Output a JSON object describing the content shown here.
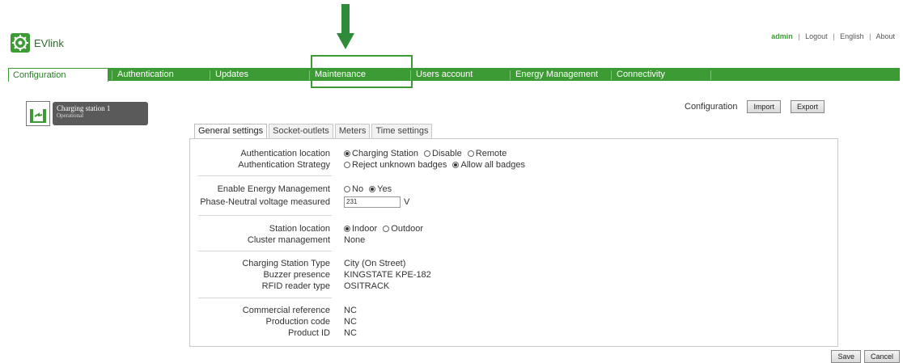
{
  "header": {
    "app_name": "EVlink",
    "user": "admin",
    "links": [
      "Logout",
      "English",
      "About"
    ],
    "separator": "|"
  },
  "nav": {
    "tabs": [
      {
        "label": "Configuration",
        "active": true
      },
      {
        "label": "Authentication",
        "active": false
      },
      {
        "label": "Updates",
        "active": false
      },
      {
        "label": "Maintenance",
        "active": false
      },
      {
        "label": "Users account",
        "active": false
      },
      {
        "label": "Energy Management",
        "active": false
      },
      {
        "label": "Connectivity",
        "active": false
      }
    ],
    "highlighted_tab": "Maintenance"
  },
  "station": {
    "name": "Charging station 1",
    "status": "Operational"
  },
  "config_bar": {
    "label": "Configuration",
    "import_label": "Import",
    "export_label": "Export"
  },
  "subtabs": [
    {
      "label": "General settings",
      "active": true
    },
    {
      "label": "Socket-outlets",
      "active": false
    },
    {
      "label": "Meters",
      "active": false
    },
    {
      "label": "Time settings",
      "active": false
    }
  ],
  "form": {
    "auth_location": {
      "label": "Authentication location",
      "options": [
        "Charging Station",
        "Disable",
        "Remote"
      ],
      "selected": "Charging Station"
    },
    "auth_strategy": {
      "label": "Authentication Strategy",
      "options": [
        "Reject unknown badges",
        "Allow all badges"
      ],
      "selected": "Allow all badges"
    },
    "energy_mgmt": {
      "label": "Enable Energy Management",
      "options": [
        "No",
        "Yes"
      ],
      "selected": "Yes"
    },
    "voltage": {
      "label": "Phase-Neutral voltage measured",
      "value": "231",
      "unit": "V"
    },
    "station_location": {
      "label": "Station location",
      "options": [
        "Indoor",
        "Outdoor"
      ],
      "selected": "Indoor"
    },
    "cluster": {
      "label": "Cluster management",
      "value": "None"
    },
    "station_type": {
      "label": "Charging Station Type",
      "value": "City (On Street)"
    },
    "buzzer": {
      "label": "Buzzer presence",
      "value": "KINGSTATE KPE-182"
    },
    "rfid": {
      "label": "RFID reader type",
      "value": "OSITRACK"
    },
    "commercial_ref": {
      "label": "Commercial reference",
      "value": "NC"
    },
    "production_code": {
      "label": "Production code",
      "value": "NC"
    },
    "product_id": {
      "label": "Product ID",
      "value": "NC"
    }
  },
  "footer": {
    "save_label": "Save",
    "cancel_label": "Cancel"
  },
  "colors": {
    "brand_green": "#3d9b35",
    "arrow_green": "#2e8b3a"
  }
}
